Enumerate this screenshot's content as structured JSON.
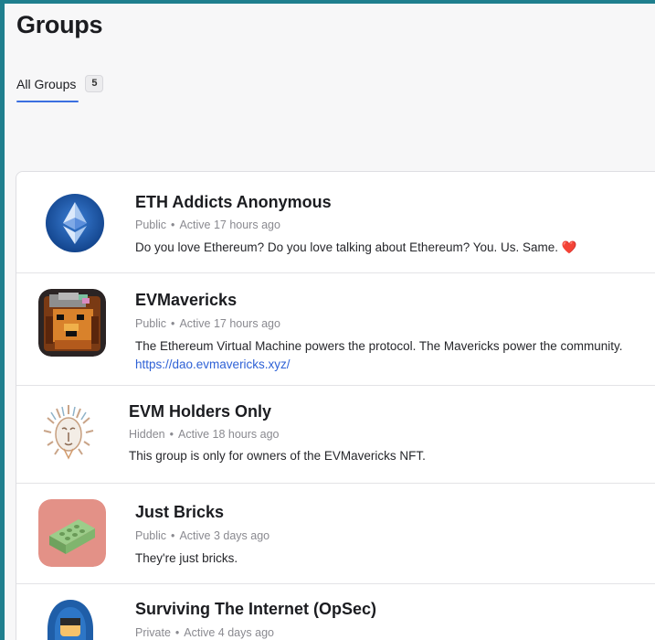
{
  "page": {
    "title": "Groups"
  },
  "tabs": [
    {
      "label": "All Groups",
      "count": "5"
    }
  ],
  "groups": [
    {
      "name": "ETH Addicts Anonymous",
      "visibility": "Public",
      "active": "Active 17 hours ago",
      "description": "Do you love Ethereum? Do you love talking about Ethereum? You. Us. Same. ❤️",
      "avatar_icon": "ethereum-logo"
    },
    {
      "name": "EVMavericks",
      "visibility": "Public",
      "active": "Active 17 hours ago",
      "description": "The Ethereum Virtual Machine powers the protocol. The Mavericks power the community.",
      "link": "https://dao.evmavericks.xyz/",
      "avatar_icon": "pixel-lion-avatar"
    },
    {
      "name": "EVM Holders Only",
      "visibility": "Hidden",
      "active": "Active 18 hours ago",
      "description": "This group is only for owners of the EVMavericks NFT.",
      "avatar_icon": "lion-head-avatar"
    },
    {
      "name": "Just Bricks",
      "visibility": "Public",
      "active": "Active 3 days ago",
      "description": "They're just bricks.",
      "avatar_icon": "brick-avatar",
      "avatar_bg": "#e39187"
    },
    {
      "name": "Surviving The Internet (OpSec)",
      "visibility": "Private",
      "active": "Active 4 days ago",
      "avatar_icon": "hooded-figure-avatar"
    }
  ],
  "meta_separator": "•"
}
